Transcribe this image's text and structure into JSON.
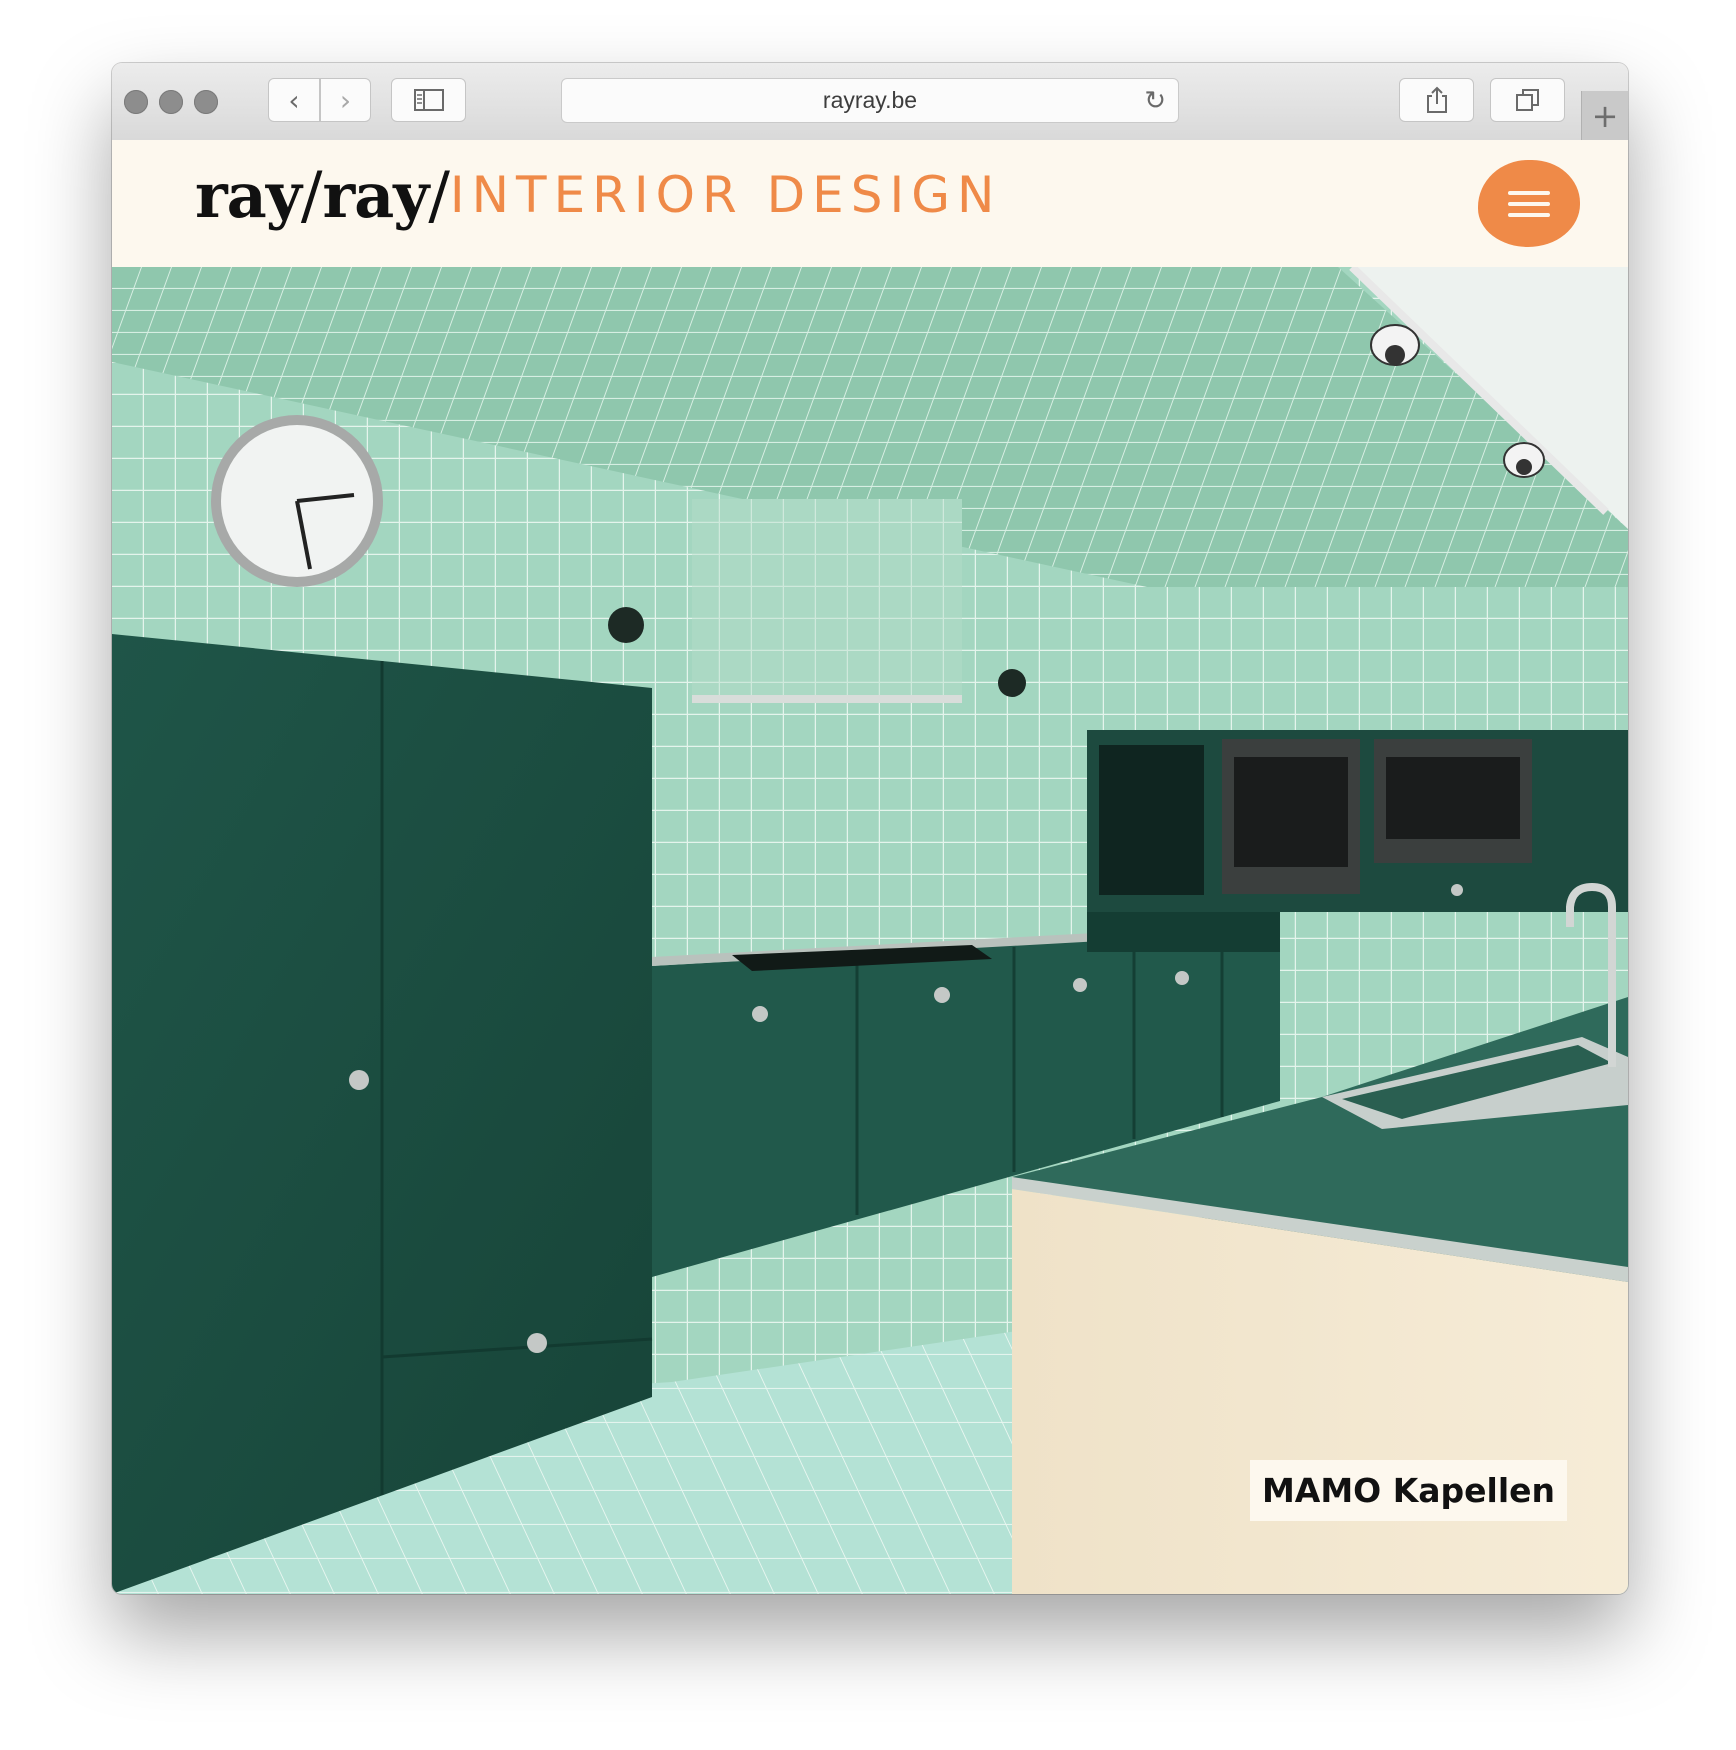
{
  "browser": {
    "url": "rayray.be",
    "icons": {
      "back": "chevron-left-icon",
      "forward": "chevron-right-icon",
      "sidebar": "sidebar-icon",
      "reload": "reload-icon",
      "share": "share-icon",
      "tabs": "tabs-icon",
      "new_tab": "plus-icon"
    }
  },
  "site": {
    "logo": {
      "part1": "ray",
      "slash1": "/",
      "part2": "ray",
      "slash2": "/",
      "tagline": "INTERIOR DESIGN"
    },
    "menu_icon": "hamburger-menu-icon",
    "hero": {
      "caption": "MAMO Kapellen",
      "image": "green-tiled-kitchen-photo"
    }
  },
  "colors": {
    "accent": "#ef8a48",
    "header_bg": "#fdf8ee",
    "tile": "#9fd2bc",
    "cabinet": "#1f5548"
  }
}
